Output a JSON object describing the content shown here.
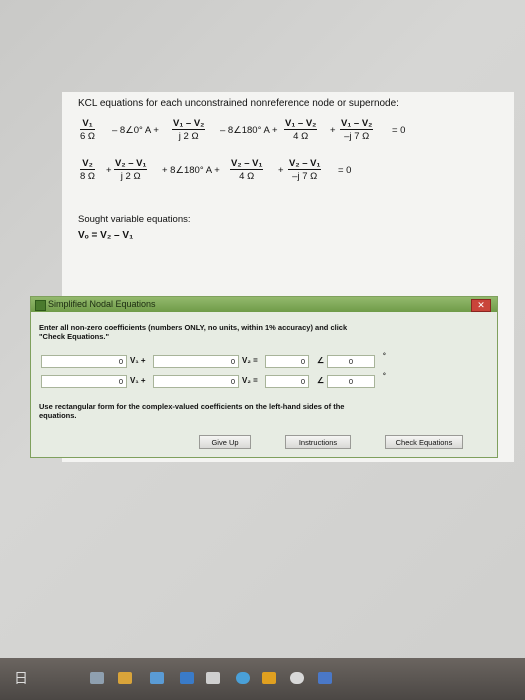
{
  "heading": "KCL equations for each unconstrained nonreference node or supernode:",
  "eq1": {
    "f1_num": "V₁",
    "f1_den": "6 Ω",
    "t1": "– 8∠0° A +",
    "f2_num": "V₁ – V₂",
    "f2_den": "j 2 Ω",
    "t2": "– 8∠180° A +",
    "f3_num": "V₁ – V₂",
    "f3_den": "4 Ω",
    "plus": "+",
    "f4_num": "V₁ – V₂",
    "f4_den": "–j 7 Ω",
    "end": "= 0"
  },
  "eq2": {
    "f1_num": "V₂",
    "f1_den": "8 Ω",
    "p1": "+",
    "f2_num": "V₂ – V₁",
    "f2_den": "j 2 Ω",
    "t2": "+ 8∠180° A +",
    "f3_num": "V₂ – V₁",
    "f3_den": "4 Ω",
    "plus": "+",
    "f4_num": "V₂ – V₁",
    "f4_den": "–j 7 Ω",
    "end": "= 0"
  },
  "sought_label": "Sought variable equations:",
  "sought_eq": "Vₒ = V₂ – V₁",
  "dialog": {
    "title": "Simplified Nodal Equations",
    "close": "✕",
    "instructions": "Enter all non-zero coefficients (numbers ONLY, no units, within 1% accuracy) and click \"Check Equations.\"",
    "row1": {
      "a": "0",
      "v1": "V₁ +",
      "b": "0",
      "v2": "V₂ =",
      "mag": "0",
      "angle_sym": "∠",
      "ang": "0",
      "deg": "°"
    },
    "row2": {
      "a": "0",
      "v1": "V₁ +",
      "b": "0",
      "v2": "V₂ =",
      "mag": "0",
      "angle_sym": "∠",
      "ang": "0",
      "deg": "°"
    },
    "note": "Use rectangular form for the complex-valued coefficients on the left-hand sides of the equations.",
    "buttons": {
      "give_up": "Give Up",
      "instructions": "Instructions",
      "check": "Check Equations"
    }
  },
  "taskbar": {
    "lang": "日"
  }
}
